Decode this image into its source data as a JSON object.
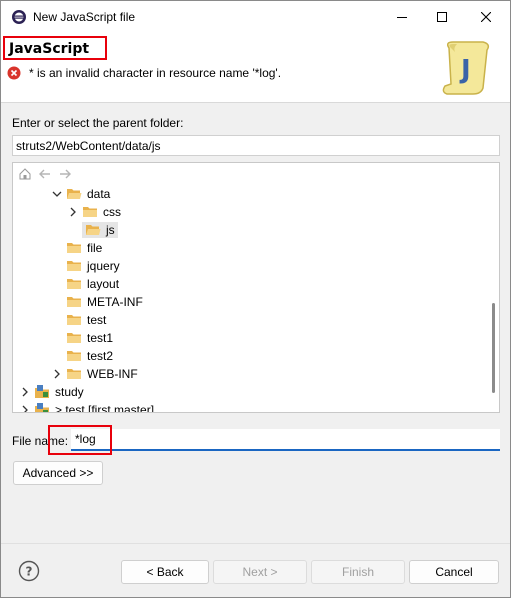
{
  "window": {
    "title": "New JavaScript file"
  },
  "banner": {
    "title": "JavaScript",
    "error_message": "* is an invalid character in resource name '*log'."
  },
  "parent_folder": {
    "label": "Enter or select the parent folder:",
    "value": "struts2/WebContent/data/js"
  },
  "tree": {
    "items": [
      {
        "label": "data",
        "expanded": true
      },
      {
        "label": "css",
        "expanded": false
      },
      {
        "label": "js",
        "selected": true
      },
      {
        "label": "file"
      },
      {
        "label": "jquery"
      },
      {
        "label": "layout"
      },
      {
        "label": "META-INF"
      },
      {
        "label": "test"
      },
      {
        "label": "test1"
      },
      {
        "label": "test2"
      },
      {
        "label": "WEB-INF",
        "expanded": false
      },
      {
        "label": "study",
        "expanded": false
      },
      {
        "label": "> test [first master]",
        "expanded": false
      }
    ]
  },
  "file_name": {
    "label": "File name:",
    "value": "*log"
  },
  "buttons": {
    "advanced": "Advanced >>",
    "back": "< Back",
    "next": "Next >",
    "finish": "Finish",
    "cancel": "Cancel"
  },
  "colors": {
    "accent": "#1a66c2",
    "highlight": "#e8000b",
    "error": "#d9342b"
  }
}
